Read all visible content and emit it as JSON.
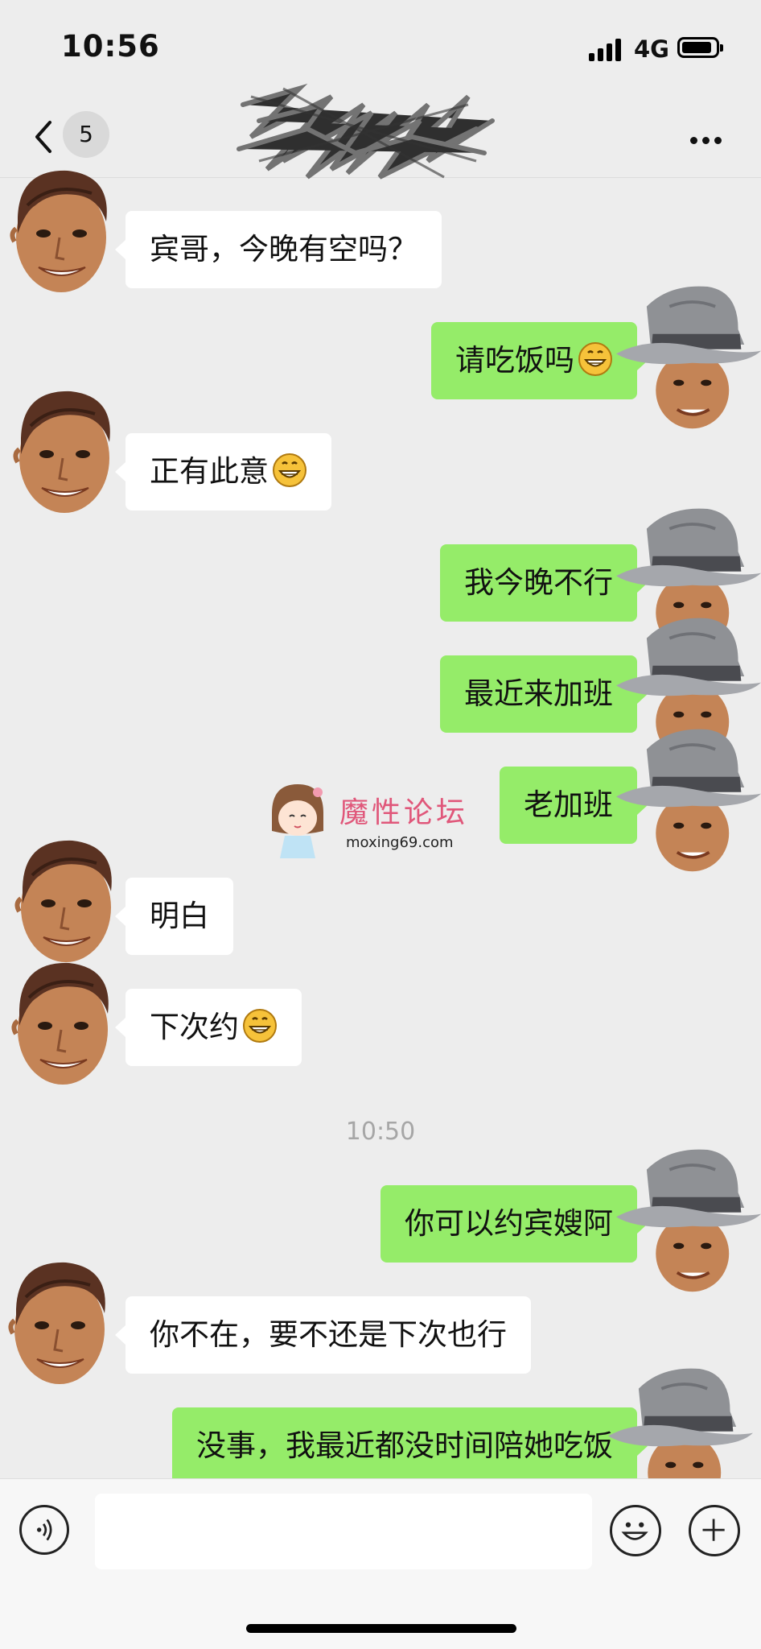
{
  "status_bar": {
    "time": "10:56",
    "network": "4G"
  },
  "header": {
    "unread_count": "5"
  },
  "messages": [
    {
      "side": "in",
      "text": "宾哥，今晚有空吗？",
      "emoji": ""
    },
    {
      "side": "out",
      "text": "请吃饭吗",
      "emoji": "grinning-face"
    },
    {
      "side": "in",
      "text": "正有此意",
      "emoji": "grinning-face"
    },
    {
      "side": "out",
      "text": "我今晚不行",
      "emoji": ""
    },
    {
      "side": "out",
      "text": "最近来加班",
      "emoji": ""
    },
    {
      "side": "out",
      "text": "老加班",
      "emoji": ""
    },
    {
      "side": "in",
      "text": "明白",
      "emoji": ""
    },
    {
      "side": "in",
      "text": "下次约",
      "emoji": "grinning-face"
    },
    {
      "side": "out",
      "text": "你可以约宾嫂阿",
      "emoji": ""
    },
    {
      "side": "in",
      "text": "你不在，要不还是下次也行",
      "emoji": ""
    },
    {
      "side": "out",
      "text": "没事，我最近都没时间陪她吃饭",
      "emoji": ""
    }
  ],
  "timestamp": "10:50",
  "watermark": {
    "title": "魔性论坛",
    "url": "moxing69.com"
  },
  "colors": {
    "background": "#ededed",
    "outgoing_bubble": "#95ec69",
    "incoming_bubble": "#ffffff",
    "watermark": "#e0577a"
  },
  "icons": {
    "back": "chevron-left-icon",
    "more": "more-dots-icon",
    "voice": "voice-icon",
    "emoji": "emoji-icon",
    "plus": "plus-icon"
  }
}
